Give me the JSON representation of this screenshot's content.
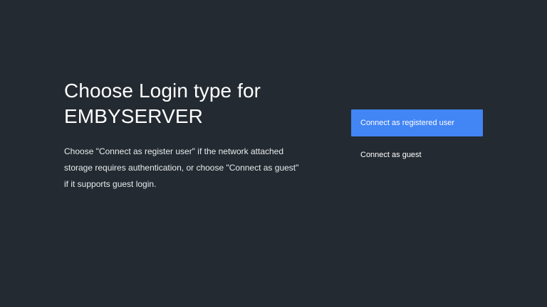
{
  "dialog": {
    "title_line1": "Choose Login type for",
    "title_line2": "EMBYSERVER",
    "description": "Choose \"Connect as register user\" if the network attached storage requires authentication, or choose \"Connect as guest\" if it supports guest login."
  },
  "options": [
    {
      "label": "Connect as registered user",
      "focused": true
    },
    {
      "label": "Connect as guest",
      "focused": false
    }
  ],
  "colors": {
    "background": "#232a31",
    "accent": "#4285f4",
    "text": "#ffffff"
  }
}
